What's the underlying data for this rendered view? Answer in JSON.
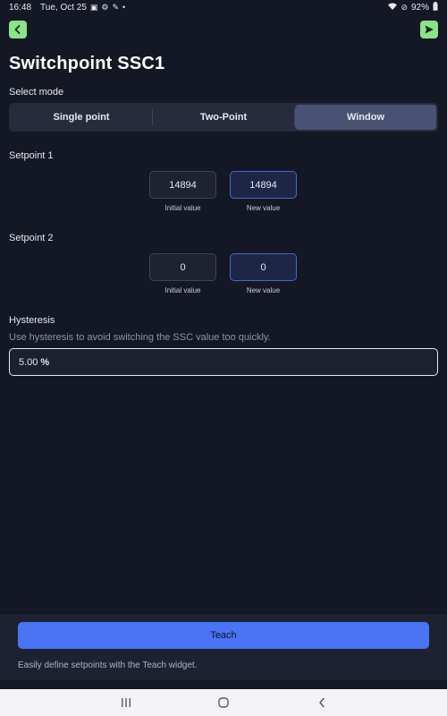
{
  "status": {
    "time": "16:48",
    "date": "Tue, Oct 25",
    "battery": "92%"
  },
  "page": {
    "title": "Switchpoint SSC1"
  },
  "mode": {
    "label": "Select mode",
    "options": [
      "Single point",
      "Two-Point",
      "Window"
    ],
    "selected": "Window"
  },
  "setpoint1": {
    "label": "Setpoint 1",
    "initial": "14894",
    "new": "14894",
    "initial_caption": "Initial value",
    "new_caption": "New value"
  },
  "setpoint2": {
    "label": "Setpoint 2",
    "initial": "0",
    "new": "0",
    "initial_caption": "Initial value",
    "new_caption": "New value"
  },
  "hysteresis": {
    "label": "Hysteresis",
    "hint": "Use hysteresis to avoid switching the SSC value too quickly.",
    "value": "5.00",
    "unit": "%"
  },
  "teach": {
    "button": "Teach",
    "hint": "Easily define setpoints with the Teach widget."
  },
  "nav": {
    "recents": "|||",
    "home": "○",
    "back": "‹"
  },
  "colors": {
    "accent_green": "#8be38a",
    "accent_blue": "#4a73f5",
    "background": "#141824"
  },
  "icons": {
    "back": "chevron-left-icon",
    "send": "send-icon"
  }
}
